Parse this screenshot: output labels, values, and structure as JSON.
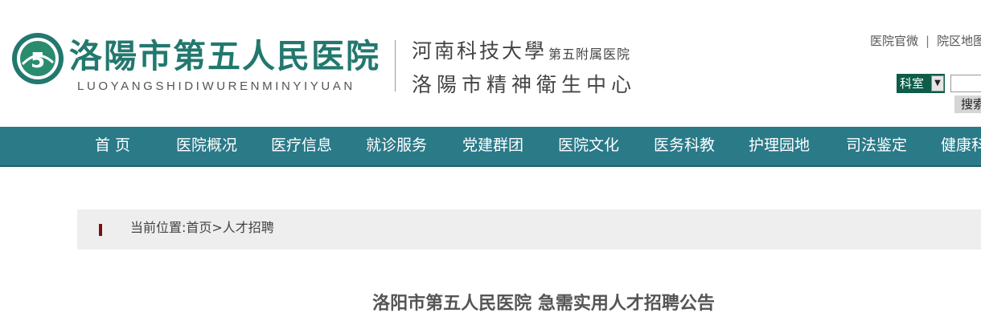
{
  "header": {
    "hospital_name": "洛陽市第五人民医院",
    "hospital_pinyin": "LUOYANGSHIDIWURENMINYIYUAN",
    "affiliation_university": "河南科技大學",
    "affiliation_hospital": "第五附属医院",
    "affiliation_center": "洛陽市精神衛生中心",
    "emblem_number": "5",
    "top_links": [
      "医院官微",
      "院区地图"
    ],
    "top_link_separator": "|",
    "dept_select": "科室",
    "search_placeholder": "",
    "search_button": "搜索"
  },
  "nav": {
    "items": [
      "首 页",
      "医院概况",
      "医疗信息",
      "就诊服务",
      "党建群团",
      "医院文化",
      "医务科教",
      "护理园地",
      "司法鉴定",
      "健康科普"
    ]
  },
  "breadcrumb": {
    "label": "当前位置:首页>人才招聘"
  },
  "article": {
    "title": "洛阳市第五人民医院 急需实用人才招聘公告"
  },
  "colors": {
    "brand_green": "#22786e",
    "nav_bg": "#2a7a88",
    "dept_select_bg": "#0e5c4a",
    "breadcrumb_bg": "#eeeeee",
    "breadcrumb_marker": "#7a1010"
  },
  "icons": {
    "emblem": "hospital-emblem-icon",
    "dropdown": "chevron-down-icon",
    "breadcrumb": "breadcrumb-marker-icon"
  }
}
